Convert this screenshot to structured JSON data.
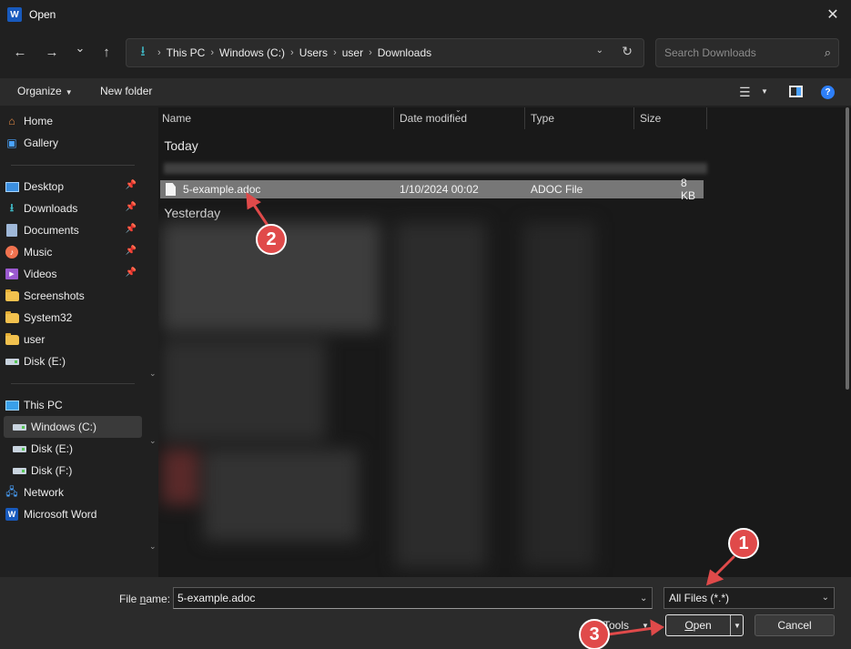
{
  "window": {
    "app_icon_letter": "W",
    "title": "Open",
    "close_glyph": "✕"
  },
  "nav": {
    "back_glyph": "←",
    "forward_glyph": "→",
    "recent_glyph": "⌄",
    "up_glyph": "↑",
    "breadcrumb": [
      "This PC",
      "Windows (C:)",
      "Users",
      "user",
      "Downloads"
    ],
    "search_placeholder": "Search Downloads"
  },
  "toolbar": {
    "organize_label": "Organize",
    "new_folder_label": "New folder",
    "help_glyph": "?"
  },
  "sidebar": {
    "quick": [
      {
        "label": "Home",
        "icon": "home-icon"
      },
      {
        "label": "Gallery",
        "icon": "gallery-icon"
      }
    ],
    "pinned": [
      {
        "label": "Desktop",
        "icon": "desktop-icon",
        "pinned": true
      },
      {
        "label": "Downloads",
        "icon": "downloads-icon",
        "pinned": true
      },
      {
        "label": "Documents",
        "icon": "documents-icon",
        "pinned": true
      },
      {
        "label": "Music",
        "icon": "music-icon",
        "pinned": true
      },
      {
        "label": "Videos",
        "icon": "videos-icon",
        "pinned": true
      },
      {
        "label": "Screenshots",
        "icon": "folder-icon"
      },
      {
        "label": "System32",
        "icon": "folder-icon"
      },
      {
        "label": "user",
        "icon": "folder-icon"
      },
      {
        "label": "Disk (E:)",
        "icon": "drive-icon"
      }
    ],
    "devices": [
      {
        "label": "This PC",
        "icon": "pc-icon"
      },
      {
        "label": "Windows (C:)",
        "icon": "drive-icon",
        "selected": true
      },
      {
        "label": "Disk (E:)",
        "icon": "drive-icon"
      },
      {
        "label": "Disk (F:)",
        "icon": "drive-icon"
      },
      {
        "label": "Network",
        "icon": "network-icon"
      },
      {
        "label": "Microsoft Word",
        "icon": "word-icon"
      }
    ]
  },
  "file_list": {
    "columns": [
      "Name",
      "Date modified",
      "Type",
      "Size"
    ],
    "groups": [
      "Today",
      "Yesterday"
    ],
    "selected_file": {
      "name": "5-example.adoc",
      "date_modified": "1/10/2024 00:02",
      "type": "ADOC File",
      "size": "8 KB"
    }
  },
  "footer": {
    "file_name_label_pre": "File ",
    "file_name_label_ul": "n",
    "file_name_label_post": "ame:",
    "file_name_value": "5-example.adoc",
    "file_type_value": "All Files (*.*)",
    "tools_label": "Tools",
    "open_label_ul": "O",
    "open_label_rest": "pen",
    "cancel_label": "Cancel"
  },
  "annotations": {
    "markers": [
      "1",
      "2",
      "3"
    ],
    "color": "#e04a4a"
  },
  "colors": {
    "accent": "#4aa3ff",
    "download_teal": "#3fb9c6",
    "word_blue": "#185abd"
  }
}
